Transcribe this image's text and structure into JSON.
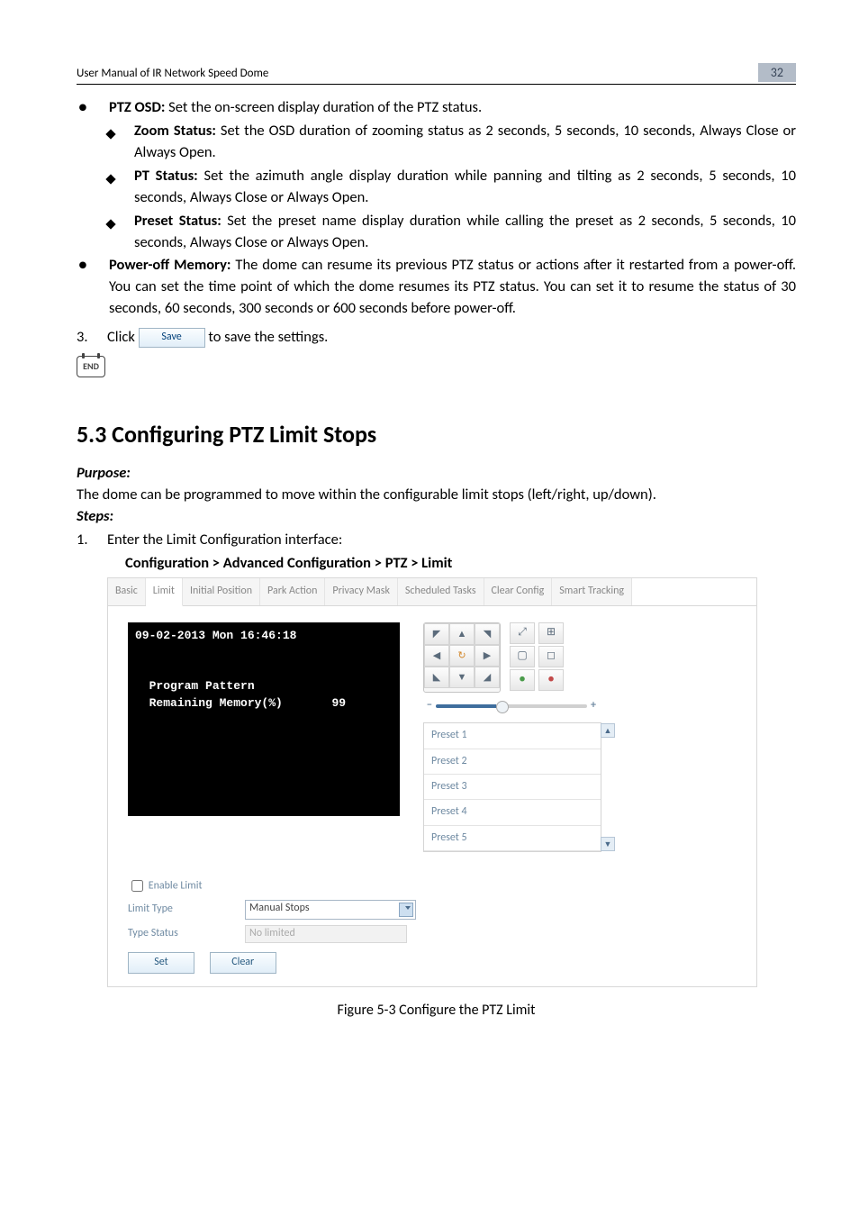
{
  "header": {
    "title": "User Manual of IR Network Speed Dome",
    "page_number": "32"
  },
  "body": {
    "ptz_osd": {
      "label": "PTZ OSD:",
      "desc": " Set the on-screen display duration of the PTZ status.",
      "zoom_label": "Zoom Status:",
      "zoom_desc": " Set the OSD duration of zooming status as 2 seconds, 5 seconds, 10 seconds, Always Close or Always Open.",
      "pt_label": "PT Status:",
      "pt_desc": " Set the azimuth angle display duration while panning and tilting as 2 seconds, 5 seconds, 10 seconds, Always Close or Always Open.",
      "preset_label": "Preset Status:",
      "preset_desc": " Set the preset name display duration while calling the preset as 2 seconds, 5 seconds, 10 seconds, Always Close or Always Open."
    },
    "poweroff": {
      "label": "Power-off Memory:",
      "desc": " The dome can resume its previous PTZ status or actions after it restarted from a power-off. You can set the time point of which the dome resumes its PTZ status. You can set it to resume the status of 30 seconds, 60 seconds, 300 seconds or 600 seconds before power-off."
    },
    "step3": {
      "prefix_num": "3.",
      "prefix_text": "Click ",
      "save_btn": "Save",
      "suffix_text": " to save the settings."
    },
    "end_label": "END"
  },
  "section": {
    "heading": "5.3  Configuring PTZ Limit Stops",
    "purpose_label": "Purpose:",
    "purpose_text": "The dome can be programmed to move within the configurable limit stops (left/right, up/down).",
    "steps_label": "Steps:",
    "step1_num": "1.",
    "step1_text": "Enter the Limit Configuration interface:",
    "step1_path": "Configuration > Advanced Configuration > PTZ > Limit"
  },
  "panel": {
    "tabs": [
      "Basic",
      "Limit",
      "Initial Position",
      "Park Action",
      "Privacy Mask",
      "Scheduled Tasks",
      "Clear Config",
      "Smart Tracking"
    ],
    "active_tab_index": 1,
    "video": {
      "timestamp": "09-02-2013 Mon 16:46:18",
      "line2": "Program Pattern",
      "line3_label": "Remaining Memory(%)",
      "line3_value": "99"
    },
    "presets": [
      "Preset 1",
      "Preset 2",
      "Preset 3",
      "Preset 4",
      "Preset 5"
    ],
    "enable_limit_label": "Enable Limit",
    "enable_limit_checked": false,
    "limit_type_label": "Limit Type",
    "limit_type_value": "Manual Stops",
    "type_status_label": "Type Status",
    "type_status_value": "No limited",
    "set_btn": "Set",
    "clear_btn": "Clear"
  },
  "figure_caption": "Figure 5-3 Configure the PTZ Limit"
}
